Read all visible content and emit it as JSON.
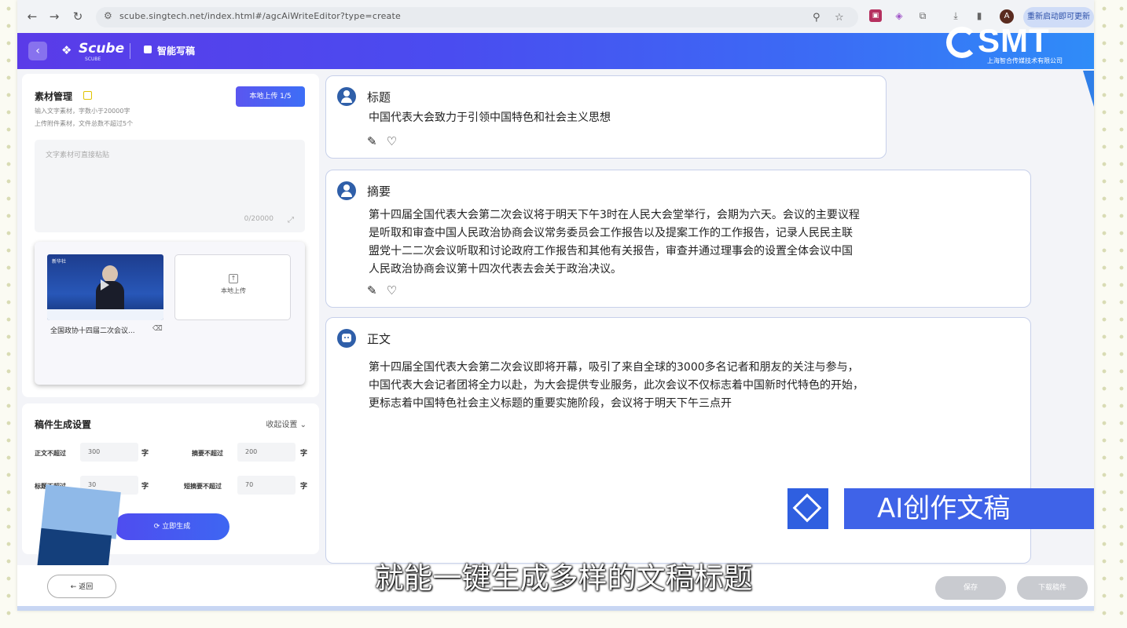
{
  "browser": {
    "url": "scube.singtech.net/index.html#/agcAiWriteEditor?type=create",
    "action_pill": "重新启动即可更新"
  },
  "header": {
    "logo": "Scube",
    "logo_sub": "SCUBE",
    "module_title": "智能写稿",
    "watermark_logo": "SMT",
    "watermark_sub": "上海智合传媒技术有限公司"
  },
  "materials": {
    "title": "素材管理",
    "hint1": "输入文字素材，字数小于20000字",
    "hint2": "上传附件素材，文件总数不超过5个",
    "upload_button": "本地上传 1/5",
    "textarea_placeholder": "文字素材可直接粘贴",
    "char_count": "0/20000",
    "video_caption": "全国政协十四届二次会议...",
    "video_logo": "新华社",
    "local_upload_label": "本地上传"
  },
  "settings": {
    "title": "稿件生成设置",
    "more_label": "收起设置",
    "fields": [
      {
        "label": "正文不超过",
        "value": "300",
        "unit": "字"
      },
      {
        "label": "摘要不超过",
        "value": "200",
        "unit": "字"
      },
      {
        "label": "标题不超过",
        "value": "30",
        "unit": "字"
      },
      {
        "label": "短摘要不超过",
        "value": "70",
        "unit": "字"
      }
    ],
    "generate_button": "立即生成"
  },
  "results": {
    "title_label": "标题",
    "title_text": "中国代表大会致力于引领中国特色和社会主义思想",
    "summary_label": "摘要",
    "summary_lines": [
      "第十四届全国代表大会第二次会议将于明天下午3时在人民大会堂举行，会期为六天。会议的主要议程",
      "是听取和审查中国人民政治协商会议常务委员会工作报告以及提案工作的工作报告，记录人民民主联",
      "盟党十二二次会议听取和讨论政府工作报告和其他有关报告，审查并通过理事会的设置全体会议中国",
      "人民政治协商会议第十四次代表去会关于政治决议。"
    ],
    "body_label": "正文",
    "body_lines": [
      "第十四届全国代表大会第二次会议即将开幕，吸引了来自全球的3000多名记者和朋友的关注与参与，",
      "中国代表大会记者团将全力以赴，为大会提供专业服务，此次会议不仅标志着中国新时代特色的开始，",
      "更标志着中国特色社会主义标题的重要实施阶段，会议将于明天下午三点开"
    ]
  },
  "badge": {
    "text": "AI创作文稿"
  },
  "footer": {
    "back_button": "返回",
    "save_button": "保存",
    "download_button": "下载稿件"
  },
  "subtitle": "就能一键生成多样的文稿标题"
}
